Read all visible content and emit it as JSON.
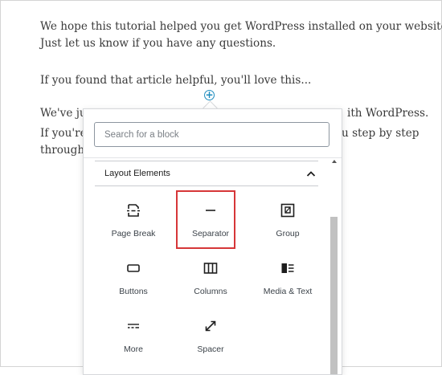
{
  "content": {
    "line1": "We hope this tutorial helped you get WordPress installed on your website.",
    "line2": "Just let us know if you have any questions.",
    "line3": "If you found that article helpful, you'll love this...",
    "line4_start": "We've ju",
    "line4_end": "ith WordPress.",
    "line5_start": "If you're",
    "line5_end": "u step by step",
    "line6_start": "through"
  },
  "inserter": {
    "search_placeholder": "Search for a block",
    "section_title": "Layout Elements",
    "blocks": [
      {
        "label": "Page Break",
        "icon": "page-break-icon"
      },
      {
        "label": "Separator",
        "icon": "separator-icon",
        "highlighted": true
      },
      {
        "label": "Group",
        "icon": "group-icon"
      },
      {
        "label": "Buttons",
        "icon": "buttons-icon"
      },
      {
        "label": "Columns",
        "icon": "columns-icon"
      },
      {
        "label": "Media & Text",
        "icon": "media-text-icon"
      },
      {
        "label": "More",
        "icon": "more-icon"
      },
      {
        "label": "Spacer",
        "icon": "spacer-icon"
      }
    ]
  },
  "colors": {
    "highlight": "#d63638",
    "accent": "#1e8cbe"
  }
}
